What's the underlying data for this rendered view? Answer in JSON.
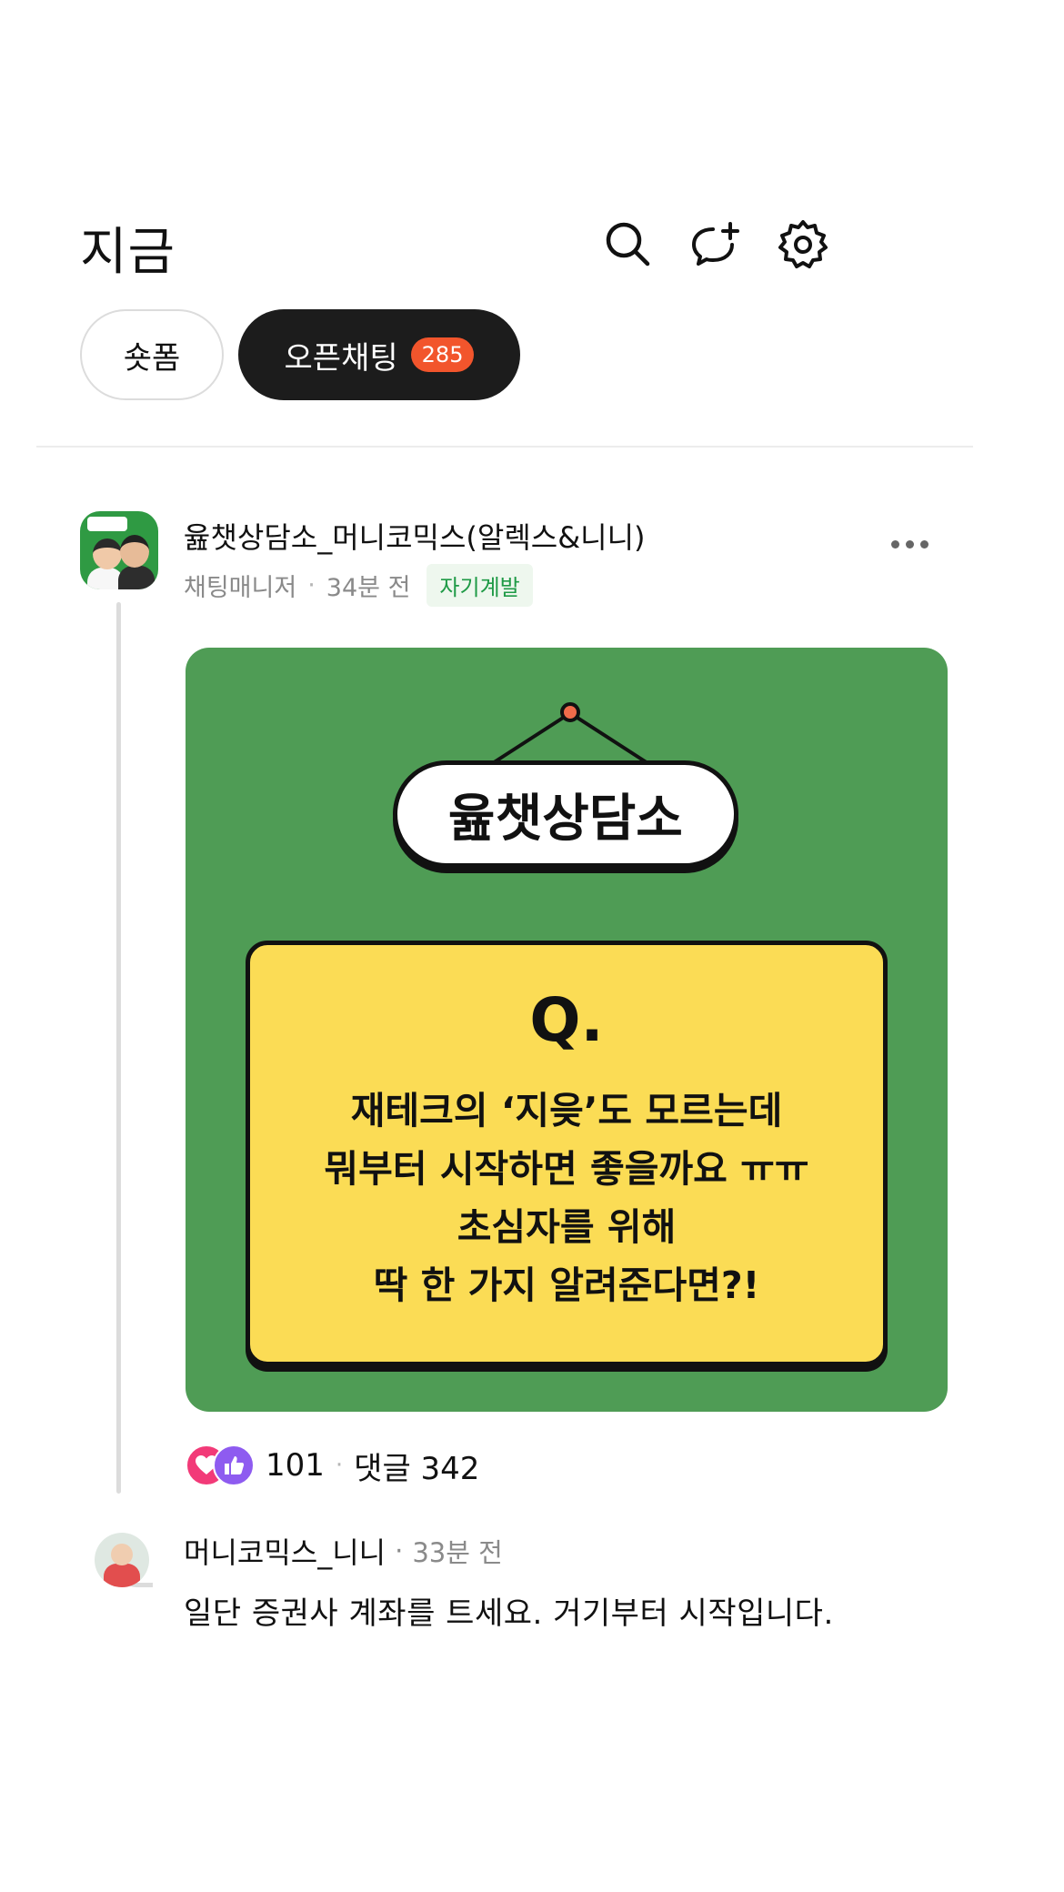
{
  "header": {
    "title": "지금",
    "icons": [
      "search-icon",
      "add-friend-chat-icon",
      "gear-icon"
    ]
  },
  "tabs": [
    {
      "label": "숏폼",
      "selected": false
    },
    {
      "label": "오픈채팅",
      "selected": true,
      "badge": "285"
    }
  ],
  "post": {
    "author": "윮챗상담소_머니코믹스(알렉스&니니)",
    "role": "채팅매니저",
    "time": "34분 전",
    "category": "자기계발",
    "image": {
      "sign": "윮챗상담소",
      "q_label": "Q.",
      "question_lines": [
        "재테크의 ‘지읒’도 모르는데",
        "뭐부터 시작하면 좋을까요 ㅠㅠ",
        "초심자를 위해",
        "딱 한 가지 알려준다면?!"
      ]
    },
    "reaction_count": "101",
    "comment_label": "댓글 342"
  },
  "comment": {
    "author": "머니코믹스_니니",
    "time": "33분 전",
    "text": "일단 증권사 계좌를 트세요. 거기부터 시작입니다."
  },
  "colors": {
    "image_bg": "#4f9c55",
    "question_box": "#fbdc55",
    "badge": "#f2552c",
    "category_text": "#1f9a46"
  }
}
